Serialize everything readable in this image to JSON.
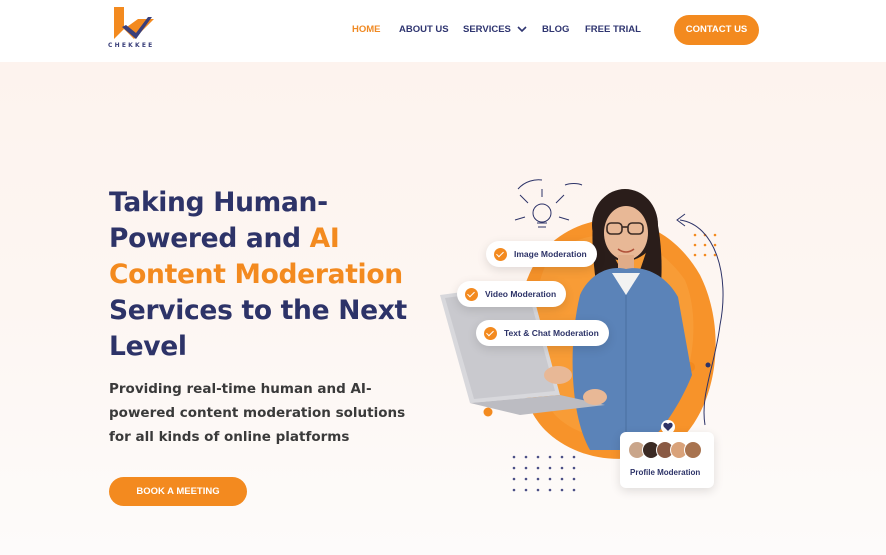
{
  "brand": {
    "name": "CHEKKEE",
    "primary": "#2d3368",
    "accent": "#f38a1f"
  },
  "nav": {
    "items": [
      {
        "label": "HOME",
        "active": true
      },
      {
        "label": "ABOUT US",
        "active": false
      },
      {
        "label": "SERVICES",
        "active": false,
        "dropdown": true
      },
      {
        "label": "BLOG",
        "active": false
      },
      {
        "label": "FREE TRIAL",
        "active": false
      }
    ],
    "contact_label": "CONTACT US"
  },
  "hero": {
    "title_line1": "Taking Human-",
    "title_line2a": "Powered and ",
    "title_line2b": "AI",
    "title_line3": "Content Moderation",
    "title_line4": "Services to the Next",
    "title_line5": "Level",
    "subtitle": "Providing real-time human and AI-powered content moderation solutions for all kinds of online platforms",
    "cta_label": "BOOK A MEETING"
  },
  "badges": {
    "image": "Image Moderation",
    "video": "Video Moderation",
    "text_chat": "Text & Chat Moderation",
    "profile": "Profile Moderation"
  }
}
